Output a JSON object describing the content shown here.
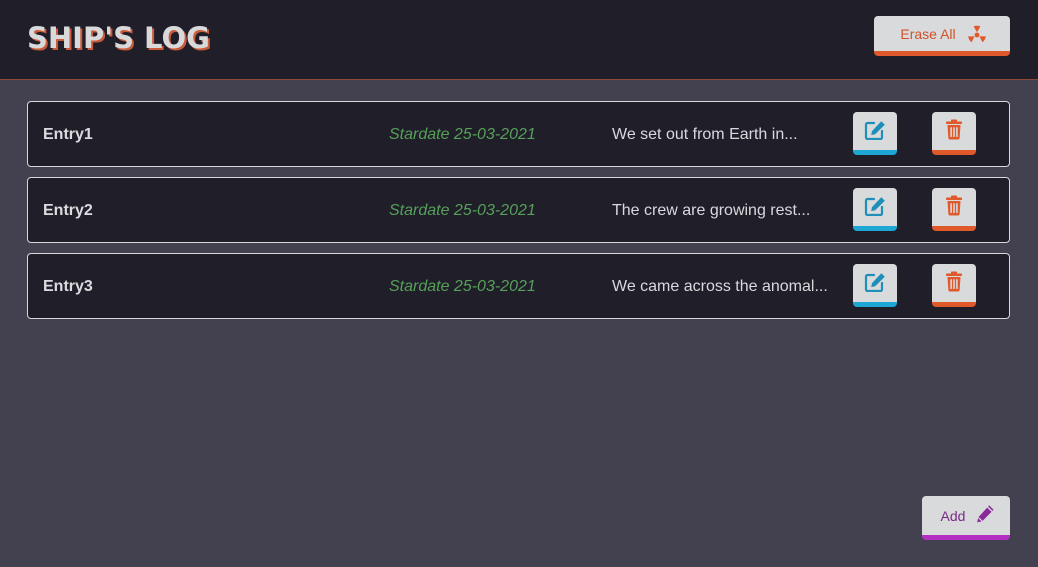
{
  "header": {
    "title": "SHIP'S LOG",
    "erase_all_label": "Erase All",
    "erase_icon": "radiation-icon"
  },
  "entries": [
    {
      "name": "Entry1",
      "date": "Stardate 25-03-2021",
      "preview": "We set out from Earth in..."
    },
    {
      "name": "Entry2",
      "date": "Stardate 25-03-2021",
      "preview": "The crew are growing rest..."
    },
    {
      "name": "Entry3",
      "date": "Stardate 25-03-2021",
      "preview": "We came across the anomal..."
    }
  ],
  "row_actions": {
    "edit_icon": "edit-icon",
    "delete_icon": "trash-icon"
  },
  "footer": {
    "add_label": "Add",
    "add_icon": "pencil-icon"
  },
  "colors": {
    "background": "#43414f",
    "panel": "#1f1e29",
    "title_shadow": "#c95a3a",
    "danger": "#e0592a",
    "edit_accent": "#1ea7d4",
    "add_accent": "#b52ec2",
    "date_green": "#56a05a"
  }
}
